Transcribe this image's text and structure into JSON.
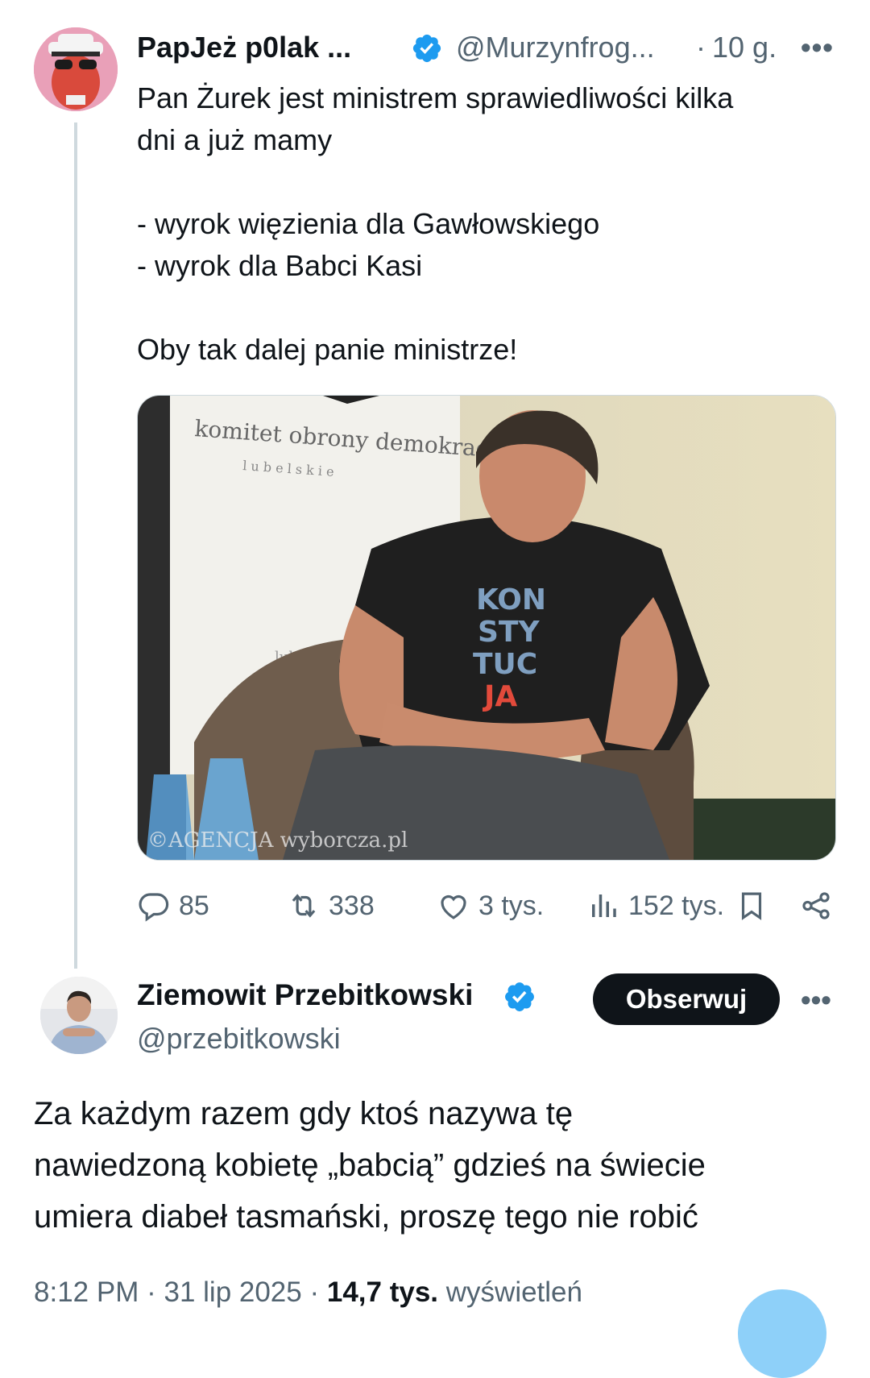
{
  "tweet": {
    "author_name": "PapJeż p0lak ...",
    "handle": "@Murzynfrog...",
    "time_ago": "10 g.",
    "more": "•••",
    "text_lines": [
      "Pan Żurek jest ministrem sprawiedliwości kilka",
      "dni a już mamy",
      "",
      "- wyrok więzienia dla Gawłowskiego",
      "- wyrok dla Babci Kasi",
      "",
      "Oby tak dalej panie ministrze!"
    ],
    "image": {
      "banner_title": "komitet obrony demokracji",
      "banner_subtitle": "l u b e l s k i e",
      "banner_partial": "lube",
      "shirt_text": [
        "KON",
        "STY",
        "TUC",
        "JA"
      ],
      "watermark": "©AGENCJA wyborcza.pl"
    },
    "stats": {
      "replies": "85",
      "retweets": "338",
      "likes": "3 tys.",
      "views": "152 tys."
    }
  },
  "reply": {
    "author_name": "Ziemowit Przebitkowski",
    "handle": "@przebitkowski",
    "follow_label": "Obserwuj",
    "more": "•••",
    "text_lines": [
      "Za każdym razem gdy ktoś nazywa tę",
      "nawiedzoną kobietę „babcią” gdzieś na świecie",
      "umiera diabeł tasmański, proszę tego nie robić"
    ],
    "footer": {
      "time": "8:12 PM",
      "date": "31 lip 2025",
      "views_count": "14,7 tys.",
      "views_label": "wyświetleń"
    }
  },
  "colors": {
    "verified": "#1d9bf0",
    "muted": "#536471",
    "follow_button": "#0f1419",
    "fab": "#8ed0f9"
  }
}
